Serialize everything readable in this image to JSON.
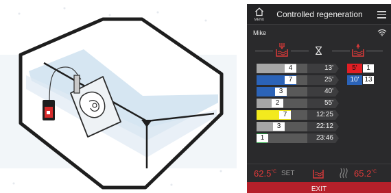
{
  "header": {
    "menu_label": "MENU",
    "title": "Controlled regeneration"
  },
  "user": "Mike",
  "rows": [
    {
      "num": "4",
      "time": "13'",
      "color": "#a6a6a6",
      "fill": 0.78
    },
    {
      "num": "7",
      "time": "25'",
      "color": "#2b63b8",
      "fill": 0.78
    },
    {
      "num": "3",
      "time": "40'",
      "color": "#2b63b8",
      "fill": 0.6
    },
    {
      "num": "2",
      "time": "55'",
      "color": "#a6a6a6",
      "fill": 0.53
    },
    {
      "num": "7",
      "time": "12:25",
      "color": "#f3ea1e",
      "fill": 0.67
    },
    {
      "num": "3",
      "time": "22:12",
      "color": "#a6a6a6",
      "fill": 0.56
    },
    {
      "num": "1",
      "time": "23:46",
      "color": "#2fb04a",
      "fill": 0.2
    }
  ],
  "regen": [
    {
      "time": "5'",
      "num": "1",
      "color": "#e31e24",
      "text_color": "#111111"
    },
    {
      "time": "10'",
      "num": "13",
      "color": "#2b63b8",
      "text_color": "#ffffff"
    }
  ],
  "footer": {
    "set_temp": "62.5",
    "set_unit": "°C",
    "set_label": "SET",
    "current_temp": "65.2",
    "current_unit": "°C"
  },
  "exit_label": "EXIT",
  "colors": {
    "accent_red": "#e31e24",
    "panel_bg": "#2a2a2c",
    "exit_bg": "#b5202a"
  },
  "icons": [
    "home-icon",
    "hamburger-icon",
    "wifi-icon",
    "heat-bath-icon",
    "hourglass-icon",
    "bath-out-icon",
    "heater-icon"
  ]
}
